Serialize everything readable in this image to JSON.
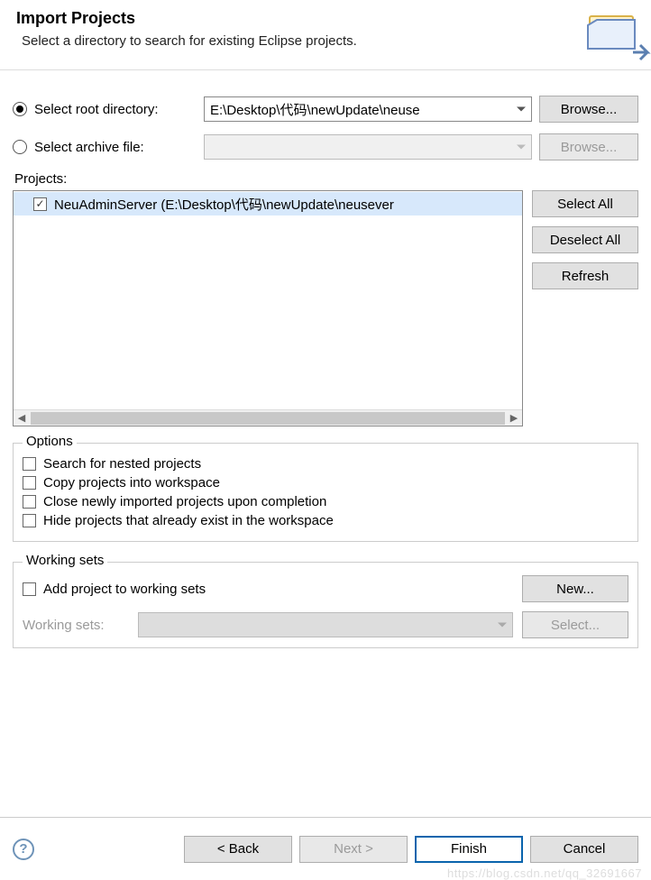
{
  "header": {
    "title": "Import Projects",
    "description": "Select a directory to search for existing Eclipse projects."
  },
  "source": {
    "rootDirLabel": "Select root directory:",
    "archiveLabel": "Select archive file:",
    "rootDirValue": "E:\\Desktop\\代码\\newUpdate\\neuse",
    "archiveValue": "",
    "browseLabel": "Browse...",
    "selectedRadio": "root"
  },
  "projects": {
    "label": "Projects:",
    "items": [
      {
        "checked": true,
        "label": "NeuAdminServer (E:\\Desktop\\代码\\newUpdate\\neusever"
      }
    ],
    "selectAll": "Select All",
    "deselectAll": "Deselect All",
    "refresh": "Refresh"
  },
  "options": {
    "groupTitle": "Options",
    "nested": "Search for nested projects",
    "copy": "Copy projects into workspace",
    "close": "Close newly imported projects upon completion",
    "hide": "Hide projects that already exist in the workspace"
  },
  "workingSets": {
    "groupTitle": "Working sets",
    "addLabel": "Add project to working sets",
    "newLabel": "New...",
    "wsLabel": "Working sets:",
    "selectLabel": "Select..."
  },
  "footer": {
    "back": "< Back",
    "next": "Next >",
    "finish": "Finish",
    "cancel": "Cancel"
  },
  "watermark": "https://blog.csdn.net/qq_32691667"
}
